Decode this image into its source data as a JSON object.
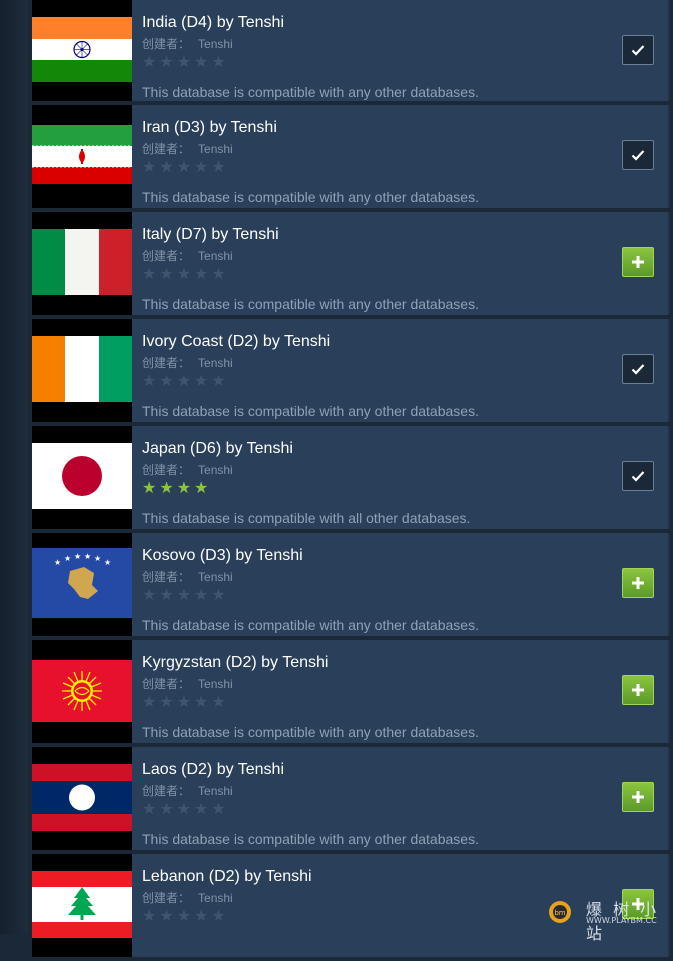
{
  "creator_label": "创建者：",
  "items": [
    {
      "flag": "india",
      "title": "India (D4) by Tenshi",
      "creator": "Tenshi",
      "stars": 0,
      "desc": "This database is compatible with any other databases.",
      "action": "check",
      "action_icon": "checkmark-icon"
    },
    {
      "flag": "iran",
      "title": "Iran (D3) by Tenshi",
      "creator": "Tenshi",
      "stars": 0,
      "desc": "This database is compatible with any other databases.",
      "action": "check",
      "action_icon": "checkmark-icon"
    },
    {
      "flag": "italy",
      "title": "Italy (D7) by Tenshi",
      "creator": "Tenshi",
      "stars": 0,
      "desc": "This database is compatible with any other databases.",
      "action": "plus",
      "action_icon": "plus-icon"
    },
    {
      "flag": "ivory-coast",
      "title": "Ivory Coast (D2) by Tenshi",
      "creator": "Tenshi",
      "stars": 0,
      "desc": "This database is compatible with any other databases.",
      "action": "check",
      "action_icon": "checkmark-icon"
    },
    {
      "flag": "japan",
      "title": "Japan (D6) by Tenshi",
      "creator": "Tenshi",
      "stars": 4,
      "desc": "This database is compatible with all other databases.",
      "action": "check",
      "action_icon": "checkmark-icon"
    },
    {
      "flag": "kosovo",
      "title": "Kosovo (D3) by Tenshi",
      "creator": "Tenshi",
      "stars": 0,
      "desc": "This database is compatible with any other databases.",
      "action": "plus",
      "action_icon": "plus-icon"
    },
    {
      "flag": "kyrgyzstan",
      "title": "Kyrgyzstan (D2) by Tenshi",
      "creator": "Tenshi",
      "stars": 0,
      "desc": "This database is compatible with any other databases.",
      "action": "plus",
      "action_icon": "plus-icon"
    },
    {
      "flag": "laos",
      "title": "Laos (D2) by Tenshi",
      "creator": "Tenshi",
      "stars": 0,
      "desc": "This database is compatible with any other databases.",
      "action": "plus",
      "action_icon": "plus-icon"
    },
    {
      "flag": "lebanon",
      "title": "Lebanon (D2) by Tenshi",
      "creator": "Tenshi",
      "stars": 0,
      "desc": "",
      "action": "plus",
      "action_icon": "plus-icon"
    }
  ],
  "colors": {
    "background": "#1b2838",
    "item_bg": "#2a3f5a",
    "star_on": "#8bc53f",
    "star_off": "#3e5470",
    "add_button": "#6fae34"
  },
  "watermark": {
    "text": "爆 树 小 站",
    "url": "WWW.PLAYBM.CC"
  }
}
